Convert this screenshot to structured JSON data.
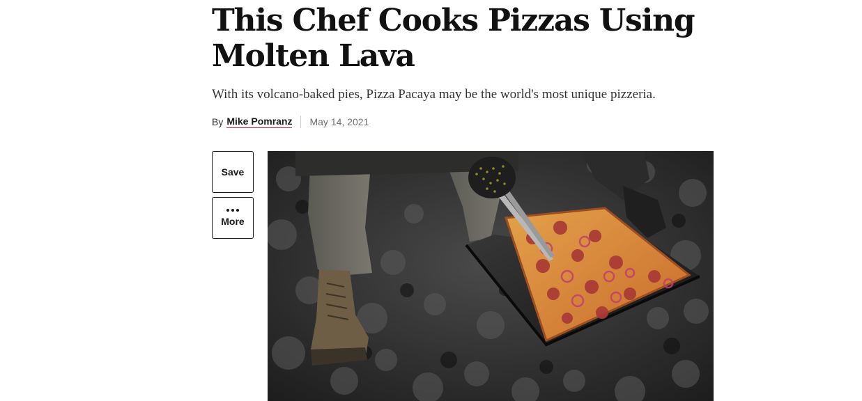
{
  "article": {
    "headline": "This Chef Cooks Pizzas Using Molten Lava",
    "dek": "With its volcano-baked pies, Pizza Pacaya may be the world's most unique pizzeria.",
    "byline": {
      "prefix": "By",
      "author": "Mike Pomranz",
      "date": "May 14, 2021"
    }
  },
  "actions": {
    "save_label": "Save",
    "more_label": "More",
    "more_icon": "ellipsis-icon"
  },
  "hero_image": {
    "subject": "hero-photo",
    "alt": ""
  },
  "colors": {
    "author_underline": "#d4213d",
    "text_primary": "#111111",
    "text_muted": "#707070"
  }
}
